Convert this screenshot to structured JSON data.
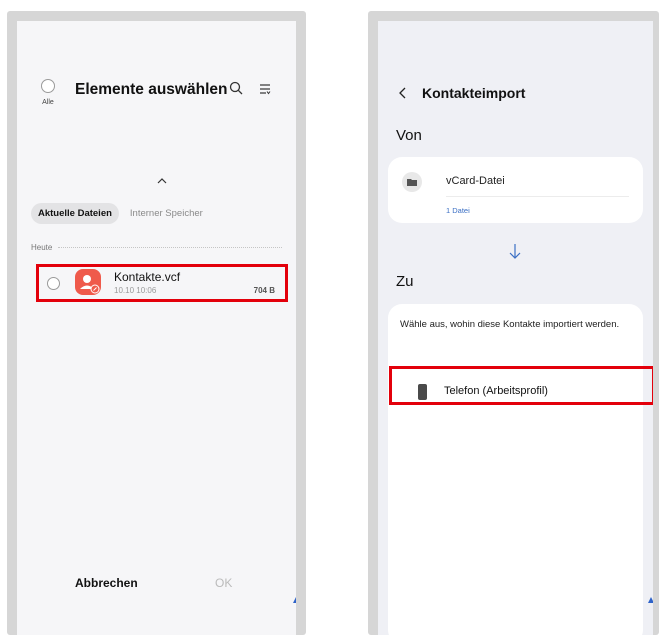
{
  "left": {
    "select_all_label": "Alle",
    "title": "Elemente auswählen",
    "tabs": [
      {
        "label": "Aktuelle Dateien",
        "active": true
      },
      {
        "label": "Interner Speicher",
        "active": false
      }
    ],
    "section_label": "Heute",
    "file": {
      "name": "Kontakte.vcf",
      "date": "10.10 10:06",
      "size": "704 B"
    },
    "cancel_label": "Abbrechen",
    "ok_label": "OK"
  },
  "right": {
    "title": "Kontakteimport",
    "from_label": "Von",
    "source": {
      "label": "vCard-Datei",
      "count": "1 Datei"
    },
    "to_label": "Zu",
    "target_description": "Wähle aus, wohin diese Kontakte importiert werden.",
    "target_option": "Telefon (Arbeitsprofil)"
  },
  "colors": {
    "highlight": "#e3000b",
    "file_icon": "#ef5a4b",
    "link_blue": "#3b6fc4",
    "nav_dot": "#2f63c9"
  },
  "icons": [
    "search-icon",
    "sort-icon",
    "chevron-up-icon",
    "contact-file-icon",
    "back-chevron-icon",
    "folder-icon",
    "arrow-down-icon",
    "phone-icon"
  ]
}
